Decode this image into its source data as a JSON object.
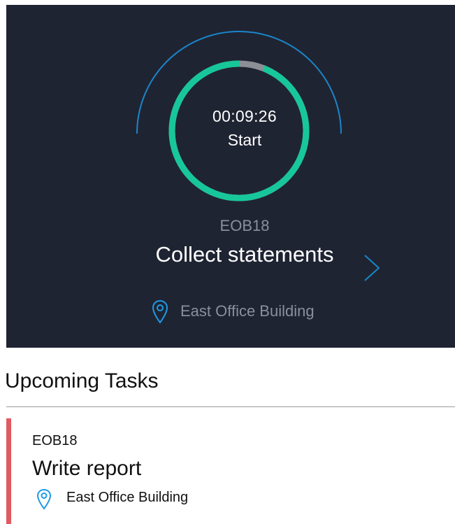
{
  "active_task": {
    "timer": "00:09:26",
    "action_label": "Start",
    "progress_elapsed_fraction": 0.94,
    "code": "EOB18",
    "title": "Collect statements",
    "location": "East Office Building"
  },
  "upcoming": {
    "section_title": "Upcoming Tasks",
    "tasks": [
      {
        "code": "EOB18",
        "title": "Write report",
        "location": "East Office Building"
      }
    ]
  },
  "colors": {
    "hero_background": "#1f2433",
    "progress_ring": "#17c79a",
    "progress_remaining": "#8c8f95",
    "outer_arc": "#1a86c8",
    "location_icon": "#1e9be6",
    "priority_bar": "#e05a61"
  },
  "icons": {
    "location": "map-pin-icon",
    "navigate": "chevron-right-icon"
  }
}
